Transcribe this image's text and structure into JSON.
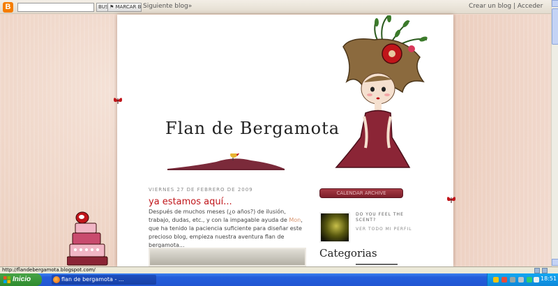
{
  "navbar": {
    "logo": "B",
    "search_btn": "BUSCAR BLOG",
    "flag_btn": "⚑ MARCAR BLOG",
    "next_blog": "Siguiente blog»",
    "create_blog": "Crear un blog",
    "separator": "|",
    "login": "Acceder"
  },
  "header": {
    "title": "Flan de Bergamota"
  },
  "post": {
    "date": "VIERNES 27 DE FEBRERO DE 2009",
    "title": "ya estamos aquí...",
    "body_before": "Después de muchos meses (¿o años?) de ilusión, trabajo, dudas, etc., y con la impagable ayuda de ",
    "body_link": "Mon",
    "body_after": ", que ha tenido la paciencia suficiente para diseñar este precioso blog, empieza nuestra aventura flan de bergamota..."
  },
  "sidebar": {
    "banner": "CALENDAR ARCHIVE",
    "profile_name": "DO YOU FEEL THE SCENT?",
    "profile_link": "VER TODO MI PERFIL",
    "categories_heading": "Categorias"
  },
  "statusbar": {
    "url": "http://flandebergamota.blogspot.com/"
  },
  "taskbar": {
    "start": "Inicio",
    "task_label": "flan de bergamota - ...",
    "clock": "18:51"
  },
  "colors": {
    "post_title": "#c0151a",
    "banner": "#7d1f2b",
    "taskbar": "#245edb"
  }
}
